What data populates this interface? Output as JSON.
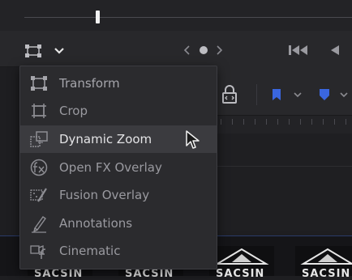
{
  "menu": {
    "items": [
      {
        "label": "Transform",
        "icon": "transform-icon"
      },
      {
        "label": "Crop",
        "icon": "crop-icon"
      },
      {
        "label": "Dynamic Zoom",
        "icon": "dynamic-zoom-icon",
        "highlighted": true
      },
      {
        "label": "Open FX Overlay",
        "icon": "open-fx-icon"
      },
      {
        "label": "Fusion Overlay",
        "icon": "fusion-overlay-icon"
      },
      {
        "label": "Annotations",
        "icon": "annotations-icon"
      },
      {
        "label": "Cinematic",
        "icon": "cinematic-icon"
      }
    ]
  },
  "thumbnails": {
    "text": [
      "SACSIN",
      "SACSIN",
      "SACSIN",
      "SACSIN"
    ]
  },
  "colors": {
    "menu_bg": "#2b2b2e",
    "hover_bg": "#3b3b3f",
    "accent_blue": "#3a66e0",
    "text_dim": "#9a9aa0",
    "text_bright": "#e4e4e6"
  }
}
